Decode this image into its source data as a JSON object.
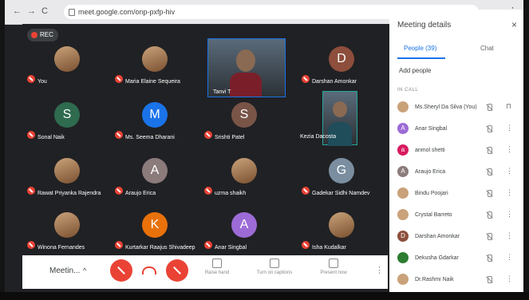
{
  "browser": {
    "back": "←",
    "forward": "→",
    "reload": "C",
    "url": "meet.google.com/onp-pxfp-hiv",
    "menu": "⋮"
  },
  "rec_label": "REC",
  "tiles": [
    {
      "name": "You",
      "initial": "",
      "color": "#c9a27a",
      "photo": true
    },
    {
      "name": "Maria Elaine Sequeira",
      "initial": "",
      "color": "#c9a27a",
      "photo": true
    },
    {
      "name": "Darshan Amonkar",
      "initial": "D",
      "color": "#8d4e3c",
      "photo": false
    },
    {
      "name": "Sonal Naik",
      "initial": "S",
      "color": "#2e6b4f",
      "photo": false
    },
    {
      "name": "Ms. Seema Dharani",
      "initial": "M",
      "color": "#1a73e8",
      "photo": false
    },
    {
      "name": "Srishti Patel",
      "initial": "S",
      "color": "#795548",
      "photo": false
    },
    {
      "name": "Rawat Priyanka Rajendra",
      "initial": "",
      "color": "#c9a27a",
      "photo": true
    },
    {
      "name": "Araujo Erica",
      "initial": "A",
      "color": "#8c7b7b",
      "photo": false
    },
    {
      "name": "uzma shaikh",
      "initial": "",
      "color": "#c9a27a",
      "photo": true
    },
    {
      "name": "Gadekar Sidhi Namdev",
      "initial": "G",
      "color": "#7a8ea0",
      "photo": false
    },
    {
      "name": "Winona Fernandes",
      "initial": "",
      "color": "#c9a27a",
      "photo": true
    },
    {
      "name": "Kurtarkar Raajus Shivadeep",
      "initial": "K",
      "color": "#e8710a",
      "photo": false
    },
    {
      "name": "Anar Singbal",
      "initial": "A",
      "color": "#9c6bd6",
      "photo": false
    },
    {
      "name": "Isha Kudalkar",
      "initial": "",
      "color": "#2e7d32",
      "photo": true
    }
  ],
  "videos": [
    {
      "name": "Tanvi T"
    },
    {
      "name": "Kezia Dacosta"
    }
  ],
  "controls": {
    "meeting_label": "Meetin...",
    "caret": "^",
    "raise_hand": "Raise hand",
    "captions": "Turn on captions",
    "present": "Present now",
    "more": "⋮"
  },
  "panel": {
    "title": "Meeting details",
    "close": "×",
    "tab_people": "People (39)",
    "tab_chat": "Chat",
    "add_people": "Add people",
    "in_call": "IN CALL",
    "people": [
      {
        "name": "Ms.Sheryl Da Silva (You)",
        "initial": "",
        "color": "#c9a27a",
        "more": "⊓"
      },
      {
        "name": "Anar Singbal",
        "initial": "A",
        "color": "#9c6bd6",
        "more": "⋮"
      },
      {
        "name": "anmol shetti",
        "initial": "a",
        "color": "#d81b60",
        "more": "⋮"
      },
      {
        "name": "Araujo Erica",
        "initial": "A",
        "color": "#8c7b7b",
        "more": "⋮"
      },
      {
        "name": "Bindu Poojari",
        "initial": "",
        "color": "#c9a27a",
        "more": "⋮"
      },
      {
        "name": "Crystal Barreto",
        "initial": "",
        "color": "#c9a27a",
        "more": "⋮"
      },
      {
        "name": "Darshan Amonkar",
        "initial": "D",
        "color": "#8d4e3c",
        "more": "⋮"
      },
      {
        "name": "Dekusha Gdarkar",
        "initial": "",
        "color": "#2e7d32",
        "more": "⋮"
      },
      {
        "name": "Dr.Rashmi Naik",
        "initial": "",
        "color": "#c9a27a",
        "more": "⋮"
      }
    ]
  }
}
